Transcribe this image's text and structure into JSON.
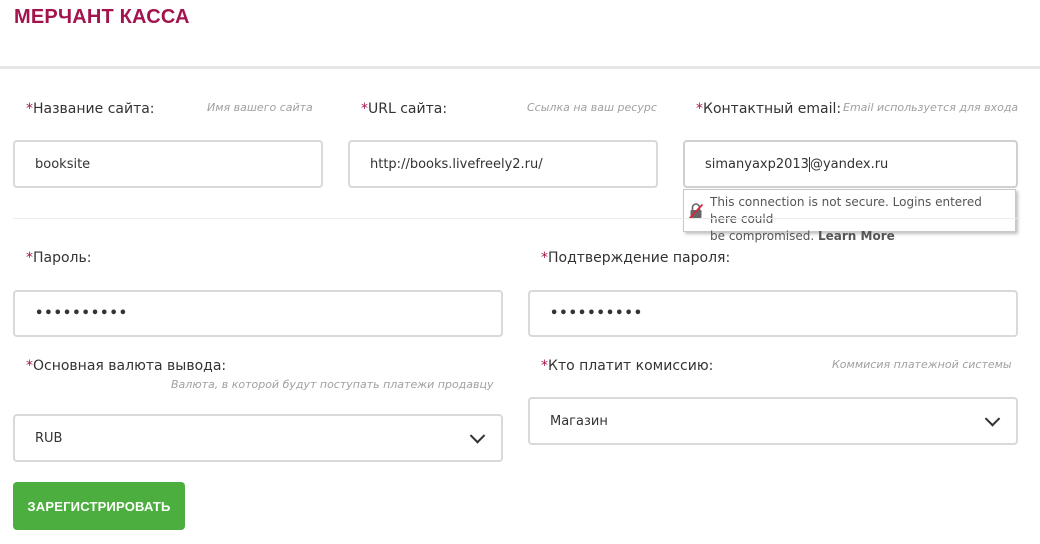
{
  "header": {
    "title": "МЕРЧАНТ КАССА"
  },
  "form": {
    "required_mark": "*",
    "site_name": {
      "label": "Название сайта:",
      "hint": "Имя вашего сайта",
      "value": "booksite"
    },
    "site_url": {
      "label": "URL сайта:",
      "hint": "Ссылка на ваш ресурс",
      "value": "http://books.livefreely2.ru/"
    },
    "email": {
      "label": "Контактный email:",
      "hint": "Email используется для входа",
      "value_before_caret": "simanyaxp2013",
      "value_after_caret": "@yandex.ru"
    },
    "password": {
      "label": "Пароль:",
      "value": "••••••••••"
    },
    "password_confirm": {
      "label": "Подтверждение пароля:",
      "value": "••••••••••"
    },
    "currency": {
      "label": "Основная валюта вывода:",
      "hint": "Валюта, в которой будут поступать платежи продавцу",
      "value": "RUB"
    },
    "commission": {
      "label": "Кто платит комиссию:",
      "hint": "Коммисия платежной системы",
      "value": "Магазин"
    },
    "submit_label": "ЗАРЕГИСТРИРОВАТЬ"
  },
  "security_tooltip": {
    "line1": "This connection is not secure. Logins entered here could",
    "line2": "be compromised.",
    "link": "Learn More",
    "icon": "insecure-lock-icon"
  },
  "colors": {
    "brand": "#a3144e",
    "button": "#4cae3e",
    "border": "#d9d9d9"
  }
}
